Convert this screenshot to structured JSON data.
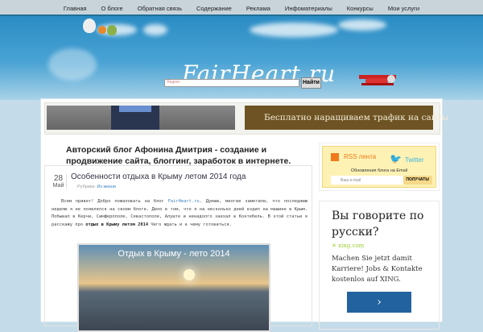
{
  "nav": [
    "Главная",
    "О блоге",
    "Обратная связь",
    "Содержание",
    "Реклама",
    "Инфоматериалы",
    "Конкурсы",
    "Мои услуги"
  ],
  "header": {
    "logo": "FairHeart.ru",
    "search_placeholder": "Яндекс",
    "search_button": "Найти"
  },
  "banner": {
    "right_text": "Бесплатно наращиваем трафик на сайты"
  },
  "blog_title": "Авторский блог Афонина Дмитрия - создание и продвижение сайта, блоггинг, заработок в интернете.",
  "post": {
    "day": "28",
    "month": "Май",
    "title": "Особенности отдыха в Крыму летом 2014 года",
    "rubric_label": "Рубрика:",
    "rubric": "Из жизни",
    "text_1": "Всем привет! Добро пожаловать на блог ",
    "link": "FairHeart.ru",
    "text_2": ". Думаю, многие заметили, что последнюю неделю я не появлялся на своем блоге. Дело в том, что я на несколько дней ездил на машине в Крым. Побывал в Керчи, Симферополе, Севастополе, Алуште и ненадолго заехал в Коктебель. В этой статьи я расскажу про ",
    "bold": "отдых в Крыму летом 2014",
    "text_3": " Чего ждать и к чему готовиться.",
    "image_caption": "Отдых в Крыму - лето 2014"
  },
  "subscribe": {
    "rss": "RSS лента",
    "twitter": "Twitter",
    "updates": "Обновления блога на Email",
    "email_placeholder": "Ваш e-mail",
    "button": "ПОЛУЧАТЬ!"
  },
  "ad": {
    "question": "Вы говорите по русски?",
    "domain": "xing.com",
    "text": "Machen Sie jetzt damit Karriere! Jobs & Kontakte kostenlos auf XING.",
    "button": "›"
  }
}
